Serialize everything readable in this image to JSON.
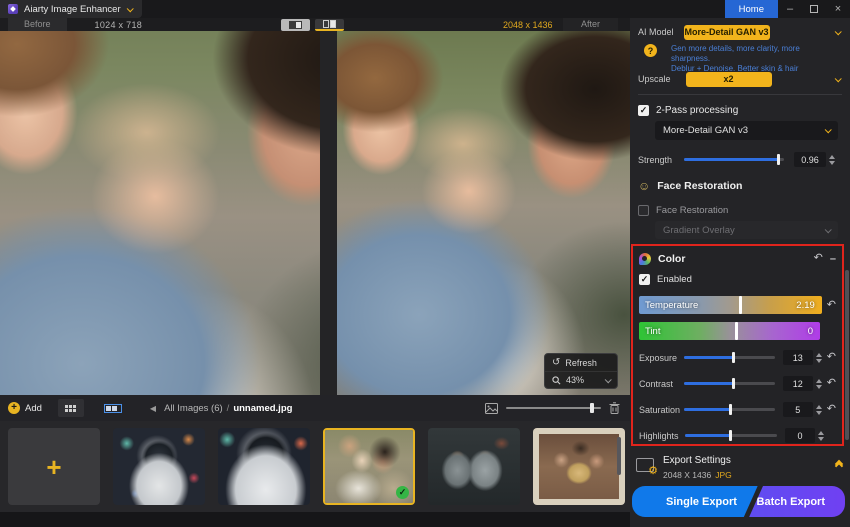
{
  "titlebar": {
    "app_title": "Aiarty Image Enhancer",
    "home_label": "Home"
  },
  "glyphs": {
    "undo": "↶",
    "refresh": "↺",
    "minimize": "–",
    "close": "×",
    "plus": "+",
    "question": "?",
    "check": "✓",
    "back": "◀",
    "gear": "⚙",
    "face": "☺",
    "add_plus": "+"
  },
  "viewer": {
    "before_label": "Before",
    "before_size": "1024 x 718",
    "after_size": "2048 x 1436",
    "after_label": "After",
    "refresh_label": "Refresh",
    "zoom_level": "43%"
  },
  "toolbar": {
    "add_label": "Add",
    "breadcrumb": "All Images (6)",
    "separator": "/",
    "current_file": "unnamed.jpg",
    "thumb_size_percent": 90
  },
  "panel": {
    "ai_model": {
      "label": "AI Model",
      "value": "More-Detail GAN  v3",
      "desc_line1": "Gen more details, more clarity, more sharpness.",
      "desc_line2": "Deblur + Denoise. Better skin & hair"
    },
    "upscale": {
      "label": "Upscale",
      "value": "x2"
    },
    "two_pass": {
      "label": "2-Pass processing",
      "model_value": "More-Detail GAN  v3"
    },
    "strength": {
      "label": "Strength",
      "value": "0.96",
      "percent": 95
    },
    "face": {
      "section_title": "Face Restoration",
      "checkbox_label": "Face Restoration",
      "dropdown_value": "Gradient Overlay"
    },
    "color": {
      "section_title": "Color",
      "enabled_label": "Enabled",
      "temperature": {
        "label": "Temperature",
        "value": "2.19",
        "percent": 56
      },
      "tint": {
        "label": "Tint",
        "value": "0",
        "percent": 54
      },
      "sliders": [
        {
          "label": "Exposure",
          "value": "13",
          "percent": 55
        },
        {
          "label": "Contrast",
          "value": "12",
          "percent": 55
        },
        {
          "label": "Saturation",
          "value": "5",
          "percent": 52
        },
        {
          "label": "Highlights",
          "value": "0",
          "percent": 50
        }
      ]
    },
    "export": {
      "title": "Export Settings",
      "resolution": "2048 X 1436",
      "format": "JPG",
      "single_label": "Single Export",
      "batch_label": "Batch Export"
    }
  },
  "colors": {
    "accent_yellow": "#f2b41c",
    "accent_blue": "#2e6ee0",
    "home_blue": "#2667d4",
    "desc_blue": "#4a7fd6",
    "highlight_red": "#e0241c",
    "single_export_blue": "#1079ea",
    "batch_export_purple": "#7040f2",
    "selected_border": "#e8b422",
    "check_green": "#35b545"
  }
}
